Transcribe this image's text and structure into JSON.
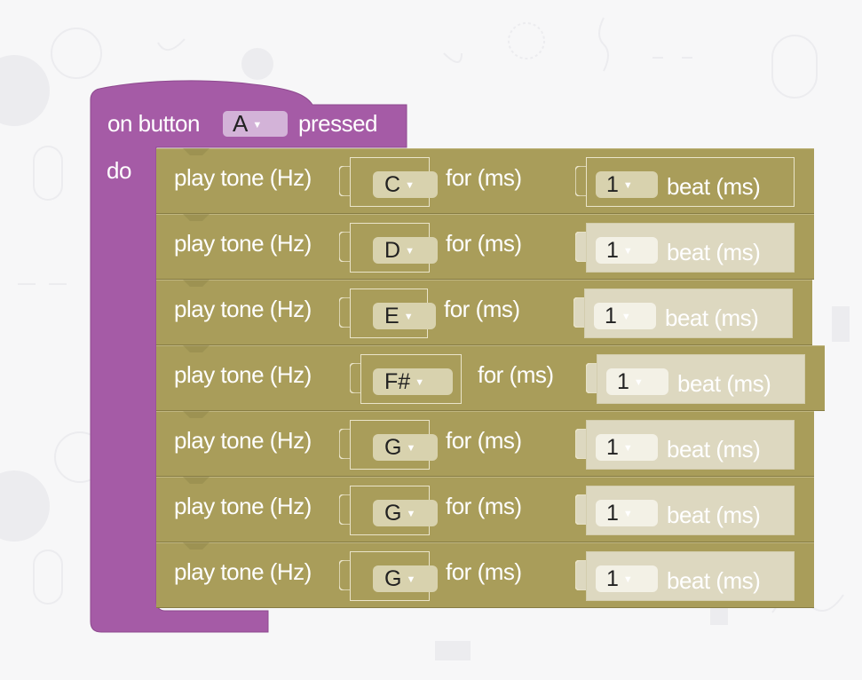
{
  "event_block": {
    "prefix_label": "on button",
    "button_value": "A",
    "suffix_label": "pressed",
    "do_label": "do",
    "color": "#a55ba6"
  },
  "tone_block_color": "#a99d5a",
  "tone_blocks": [
    {
      "label": "play tone (Hz)",
      "note": "C",
      "for_label": "for (ms)",
      "beat_value": "1",
      "beat_label": "beat (ms)"
    },
    {
      "label": "play tone (Hz)",
      "note": "D",
      "for_label": "for (ms)",
      "beat_value": "1",
      "beat_label": "beat (ms)"
    },
    {
      "label": "play tone (Hz)",
      "note": "E",
      "for_label": "for (ms)",
      "beat_value": "1",
      "beat_label": "beat (ms)"
    },
    {
      "label": "play tone (Hz)",
      "note": "F#",
      "for_label": "for (ms)",
      "beat_value": "1",
      "beat_label": "beat (ms)"
    },
    {
      "label": "play tone (Hz)",
      "note": "G",
      "for_label": "for (ms)",
      "beat_value": "1",
      "beat_label": "beat (ms)"
    },
    {
      "label": "play tone (Hz)",
      "note": "G",
      "for_label": "for (ms)",
      "beat_value": "1",
      "beat_label": "beat (ms)"
    },
    {
      "label": "play tone (Hz)",
      "note": "G",
      "for_label": "for (ms)",
      "beat_value": "1",
      "beat_label": "beat (ms)"
    }
  ],
  "icons": {
    "dropdown": "dropdown-caret-icon"
  }
}
